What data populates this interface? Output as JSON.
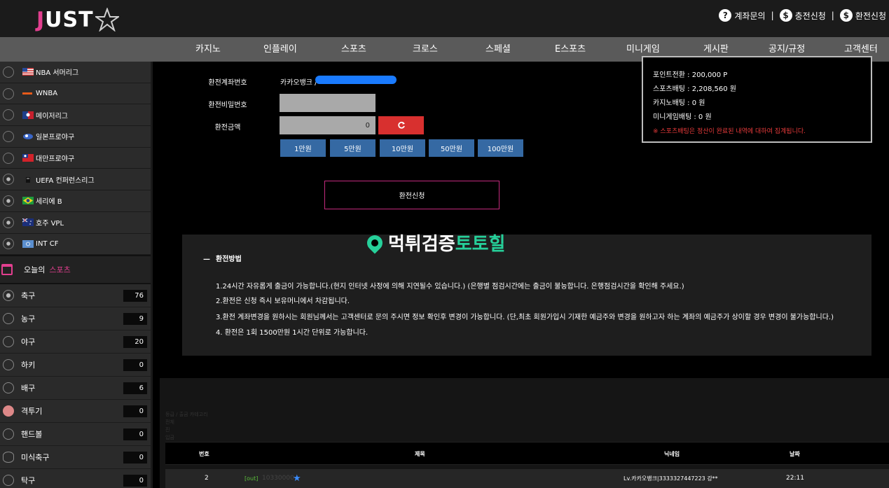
{
  "header": {
    "logo_text": "JUST",
    "links": [
      {
        "icon": "question-icon",
        "icon_glyph": "?",
        "label": "계좌문의"
      },
      {
        "icon": "coin-icon",
        "icon_glyph": "$",
        "label": "충전신청"
      },
      {
        "icon": "wallet-icon",
        "icon_glyph": "$",
        "label": "환전신청"
      }
    ],
    "separator": "|"
  },
  "nav": [
    "카지노",
    "인플레이",
    "스포츠",
    "크로스",
    "스페셜",
    "E스포츠",
    "미니게임",
    "게시판",
    "공지/규정",
    "고객센터"
  ],
  "sidebar": {
    "leagues": [
      {
        "icon": "basketball-icon",
        "flag": "us-flag-icon",
        "label": "NBA 서머리그"
      },
      {
        "icon": "basketball-icon",
        "flag": "wnba-logo-icon",
        "label": "WNBA"
      },
      {
        "icon": "baseball-icon",
        "flag": "mlb-logo-icon",
        "label": "메이저리그"
      },
      {
        "icon": "baseball-icon",
        "flag": "npb-logo-icon",
        "label": "일본프로야구"
      },
      {
        "icon": "baseball-icon",
        "flag": "taiwan-flag-icon",
        "label": "대만프로야구"
      },
      {
        "icon": "soccer-icon",
        "flag": "uefa-logo-icon",
        "label": "UEFA 컨퍼런스리그"
      },
      {
        "icon": "soccer-icon",
        "flag": "brazil-flag-icon",
        "label": "세리에 B"
      },
      {
        "icon": "soccer-icon",
        "flag": "australia-flag-icon",
        "label": "호주 VPL"
      },
      {
        "icon": "soccer-icon",
        "flag": "int-flag-icon",
        "label": "INT CF"
      }
    ],
    "today": {
      "label": "오늘의",
      "highlight": "스포츠"
    },
    "sports": [
      {
        "icon": "soccer-icon",
        "label": "축구",
        "count": "76"
      },
      {
        "icon": "basketball-icon",
        "label": "농구",
        "count": "9"
      },
      {
        "icon": "baseball-icon",
        "label": "야구",
        "count": "20"
      },
      {
        "icon": "hockey-icon",
        "label": "하키",
        "count": "0"
      },
      {
        "icon": "volleyball-icon",
        "label": "배구",
        "count": "6"
      },
      {
        "icon": "boxing-glove-icon",
        "label": "격투기",
        "count": "0"
      },
      {
        "icon": "handball-icon",
        "label": "핸드볼",
        "count": "0"
      },
      {
        "icon": "football-icon",
        "label": "미식축구",
        "count": "0"
      },
      {
        "icon": "table-tennis-icon",
        "label": "탁구",
        "count": "0"
      }
    ]
  },
  "form": {
    "account_label": "환전계좌번호",
    "account_value": "카카오뱅크 /",
    "password_label": "환전비밀번호",
    "password_value": "",
    "amount_label": "환전금액",
    "amount_value": "0",
    "reset_icon": "refresh-icon",
    "amount_buttons": [
      "1만원",
      "5만원",
      "10만원",
      "50만원",
      "100만원"
    ],
    "submit_label": "환전신청"
  },
  "info_box": {
    "lines": [
      "포인트전환 : 200,000 P",
      "스포츠배팅 : 2,208,560 원",
      "카지노배팅 : 0 원",
      "미니게임배팅 : 0 원"
    ],
    "warning": "※ 스포츠배팅은 정산이 완료된 내역에 대하여 집계됩니다."
  },
  "method": {
    "title": "환전방법",
    "lines": [
      "1.24시간 자유롭게 출금이 가능합니다.(현지 인터넷 사정에 의해 지연될수 있습니다.) (은행별 점검시간에는 출금이 불능합니다. 은행점검시간을 확인해 주세요.)",
      "2.환전은 신청 즉시 보유머니에서 차감됩니다.",
      "3.환전 계좌변경을 원하시는 회원님께서는 고객센터로 문의 주시면 정보 확인후 변경이 가능합니다. (단,최초 회원가입시 기재한 예금주와 변경을 원하고자 하는 계좌의 예금주가 상이할 경우 변경이 불가능합니다.)",
      "4. 환전은 1회 1500만원 1시간 단위로 가능합니다."
    ]
  },
  "watermark": {
    "part1": "먹튀검증",
    "part2": "토토힐",
    "icon": "location-pin-icon"
  },
  "board": {
    "breadcrumb": "등급 / 출금 카테고리",
    "sub_lines": [
      "전체",
      "진",
      "입금"
    ],
    "headers": [
      "번호",
      "제목",
      "닉네임",
      "날짜"
    ],
    "rows": [
      {
        "no": "2",
        "tag": "[out]",
        "title": "10330000",
        "nickname": "Lv.카카오뱅크|3333327447223 강**",
        "date": "22:11"
      }
    ]
  }
}
